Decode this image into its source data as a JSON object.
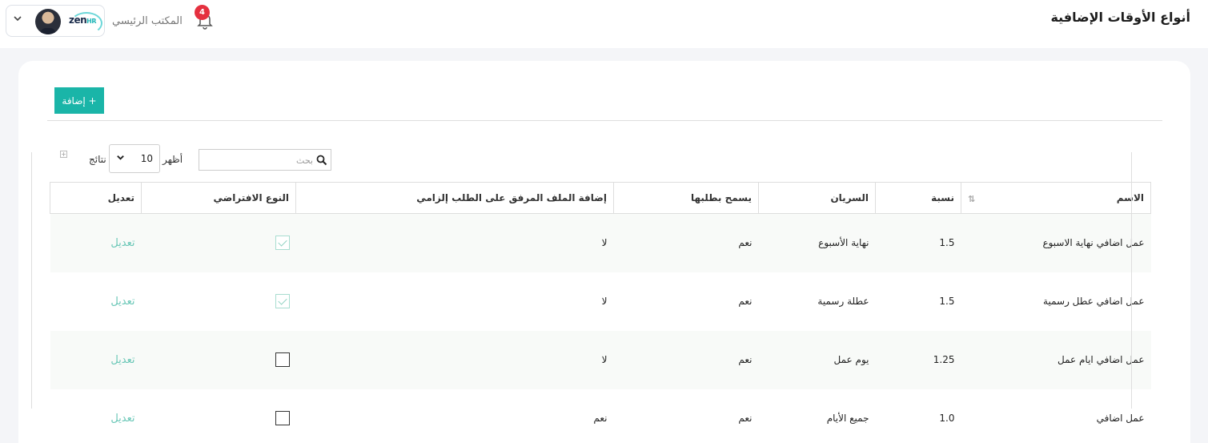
{
  "header": {
    "title": "أنواع الأوقات الإضافية",
    "office": "المكتب الرئيسي",
    "notification_count": "4",
    "brand": {
      "name": "zen",
      "suffix": "HR"
    }
  },
  "toolbar": {
    "add_label": "+ إضافة"
  },
  "controls": {
    "search_placeholder": "بحث",
    "show_label": "أظهر",
    "page_size": "10",
    "results_label": "نتائج"
  },
  "table": {
    "columns": [
      "الاسم",
      "نسبة",
      "السريان",
      "يسمح بطلبها",
      "إضافة الملف المرفق على الطلب إلزامي",
      "النوع الافتراضي",
      "تعديل"
    ],
    "rows": [
      {
        "name": "عمل اضافي نهاية الاسبوع",
        "rate": "1.5",
        "applies": "نهاية الأسبوع",
        "allowed": "نعم",
        "attachment_required": "لا",
        "default": true,
        "edit": "تعديل"
      },
      {
        "name": "عمل اضافي عطل رسمية",
        "rate": "1.5",
        "applies": "عطلة رسمية",
        "allowed": "نعم",
        "attachment_required": "لا",
        "default": true,
        "edit": "تعديل"
      },
      {
        "name": "عمل اضافي ايام عمل",
        "rate": "1.25",
        "applies": "يوم عمل",
        "allowed": "نعم",
        "attachment_required": "لا",
        "default": false,
        "edit": "تعديل"
      },
      {
        "name": "عمل اضافي",
        "rate": "1.0",
        "applies": "جميع الأيام",
        "allowed": "نعم",
        "attachment_required": "نعم",
        "default": false,
        "edit": "تعديل"
      }
    ]
  },
  "colors": {
    "accent": "#1ab5a8",
    "badge": "#e5303f",
    "edit_link": "#6ac7b7"
  }
}
